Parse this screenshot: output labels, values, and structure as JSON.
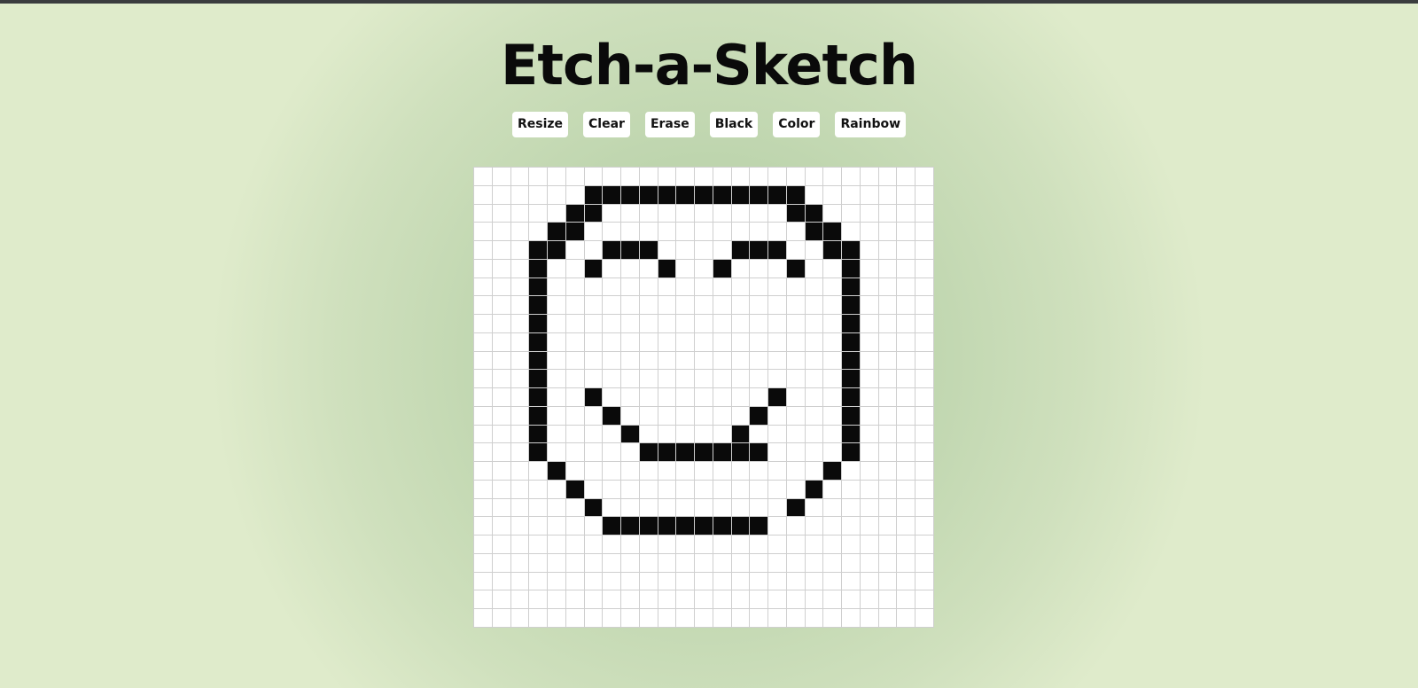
{
  "app": {
    "title": "Etch-a-Sketch"
  },
  "controls": [
    {
      "id": "resize",
      "label": "Resize"
    },
    {
      "id": "clear",
      "label": "Clear"
    },
    {
      "id": "erase",
      "label": "Erase"
    },
    {
      "id": "black",
      "label": "Black"
    },
    {
      "id": "color",
      "label": "Color"
    },
    {
      "id": "rainbow",
      "label": "Rainbow"
    }
  ],
  "grid": {
    "rows": 25,
    "cols": 25,
    "fill_color": "#0a0a0a",
    "empty_color": "#ffffff",
    "line_color": "#cfcfcf",
    "pattern": [
      ".........................",
      "......############.......",
      ".....##..........##......",
      "....##............##.....",
      "...##..###....###..##....",
      "...#..#...#..#...#..#....",
      "...#................#....",
      "...#................#....",
      "...#................#....",
      "...#................#....",
      "...#................#....",
      "...#................#....",
      "...#..#.........#...#....",
      "...#...#.......#....#....",
      "...#....#.....#.....#....",
      "...#.....#######....#....",
      "....#..............#.....",
      ".....#............#......",
      "......#..........#.......",
      ".......#########.........",
      ".........................",
      ".........................",
      ".........................",
      ".........................",
      "........................."
    ]
  },
  "colors": {
    "background": "#c6dab5",
    "topbar": "#3b3d3f",
    "button_bg": "#ffffff",
    "title": "#0a0a0a"
  }
}
